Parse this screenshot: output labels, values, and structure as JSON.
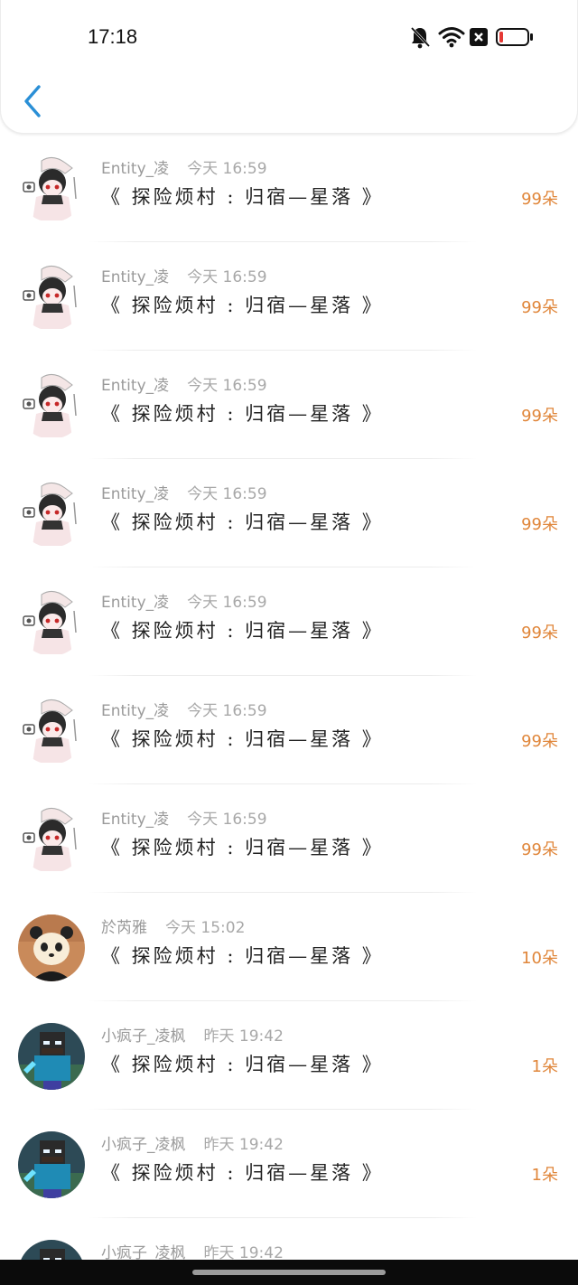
{
  "status_bar": {
    "time": "17:18",
    "icons": [
      "bell-muted-icon",
      "wifi-icon",
      "sim-none-icon",
      "battery-low-icon"
    ],
    "battery_color": "#e53935"
  },
  "header": {
    "back_icon": "chevron-left-icon",
    "accent": "#2a8fd6"
  },
  "colors": {
    "amount": "#e0863a",
    "meta": "#9a9a9a",
    "title": "#222222"
  },
  "gifts": [
    {
      "avatar": "anime-avatar",
      "user": "Entity_凌",
      "time": "今天 16:59",
      "title": "《 探险烦村 : 归宿—星落 》",
      "amount": "99朵"
    },
    {
      "avatar": "anime-avatar",
      "user": "Entity_凌",
      "time": "今天 16:59",
      "title": "《 探险烦村 : 归宿—星落 》",
      "amount": "99朵"
    },
    {
      "avatar": "anime-avatar",
      "user": "Entity_凌",
      "time": "今天 16:59",
      "title": "《 探险烦村 : 归宿—星落 》",
      "amount": "99朵"
    },
    {
      "avatar": "anime-avatar",
      "user": "Entity_凌",
      "time": "今天 16:59",
      "title": "《 探险烦村 : 归宿—星落 》",
      "amount": "99朵"
    },
    {
      "avatar": "anime-avatar",
      "user": "Entity_凌",
      "time": "今天 16:59",
      "title": "《 探险烦村 : 归宿—星落 》",
      "amount": "99朵"
    },
    {
      "avatar": "anime-avatar",
      "user": "Entity_凌",
      "time": "今天 16:59",
      "title": "《 探险烦村 : 归宿—星落 》",
      "amount": "99朵"
    },
    {
      "avatar": "anime-avatar",
      "user": "Entity_凌",
      "time": "今天 16:59",
      "title": "《 探险烦村 : 归宿—星落 》",
      "amount": "99朵"
    },
    {
      "avatar": "panda-avatar",
      "user": "於芮雅",
      "time": "今天 15:02",
      "title": "《 探险烦村 : 归宿—星落 》",
      "amount": "10朵"
    },
    {
      "avatar": "minecraft-avatar",
      "user": "小疯子_凌枫",
      "time": "昨天 19:42",
      "title": "《 探险烦村 : 归宿—星落 》",
      "amount": "1朵"
    },
    {
      "avatar": "minecraft-avatar",
      "user": "小疯子_凌枫",
      "time": "昨天 19:42",
      "title": "《 探险烦村 : 归宿—星落 》",
      "amount": "1朵"
    },
    {
      "avatar": "minecraft-avatar",
      "user": "小疯子_凌枫",
      "time": "昨天 19:42",
      "title": "",
      "amount": ""
    }
  ]
}
